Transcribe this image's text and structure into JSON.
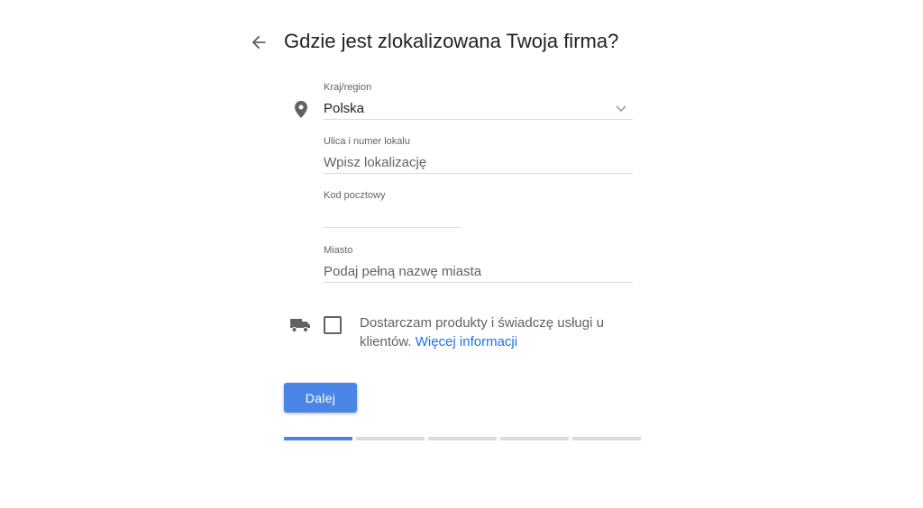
{
  "header": {
    "title": "Gdzie jest zlokalizowana Twoja firma?",
    "back_icon": "arrow-left-icon"
  },
  "form": {
    "country": {
      "label": "Kraj/region",
      "value": "Polska",
      "icon": "location-pin-icon"
    },
    "street": {
      "label": "Ulica i numer lokalu",
      "placeholder": "Wpisz lokalizację"
    },
    "postal_code": {
      "label": "Kod pocztowy",
      "value": ""
    },
    "city": {
      "label": "Miasto",
      "placeholder": "Podaj pełną nazwę miasta"
    },
    "delivery": {
      "icon": "truck-icon",
      "checked": false,
      "text": "Dostarczam produkty i świadczę usługi u klientów.",
      "link": "Więcej informacji"
    }
  },
  "actions": {
    "next_label": "Dalej"
  },
  "progress": {
    "steps_total": 5,
    "current_step": 1
  },
  "colors": {
    "accent": "#4a86e8",
    "link": "#1a73e8",
    "divider": "#dadce0"
  }
}
